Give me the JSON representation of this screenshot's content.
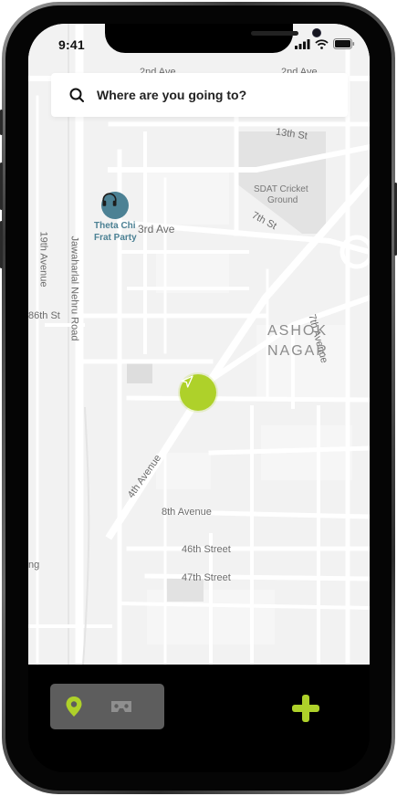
{
  "status_bar": {
    "time": "9:41"
  },
  "search": {
    "placeholder": "Where are you going to?"
  },
  "map": {
    "labels": {
      "ave2_left": "2nd Ave",
      "ave2_right": "2nd Ave",
      "st13": "13th St",
      "st7": "7th St",
      "ave3": "3rd Ave",
      "ave19": "19th Avenue",
      "nehru_road": "Jawaharlal Nehru Road",
      "st86": "86th St",
      "ave7": "7th Avenue",
      "ave4": "4th Avenue",
      "ave8": "8th Avenue",
      "st46": "46th Street",
      "st47": "47th Street",
      "edge_partial": "ng",
      "area_name_line1": "ASHOK",
      "area_name_line2": "NAGAR",
      "sdat_line1": "SDAT Cricket",
      "sdat_line2": "Ground"
    },
    "poi": {
      "name_line1": "Theta Chi",
      "name_line2": "Frat Party",
      "icon": "headphones-icon"
    }
  },
  "bottom_bar": {
    "tabs": [
      {
        "icon": "location-pin-icon",
        "active": true
      },
      {
        "icon": "vr-headset-icon",
        "active": false
      }
    ],
    "add_icon": "plus-icon"
  },
  "colors": {
    "accent": "#aed12a",
    "poi": "#4c8194",
    "map_bg": "#f2f2f2",
    "road": "#ffffff"
  }
}
